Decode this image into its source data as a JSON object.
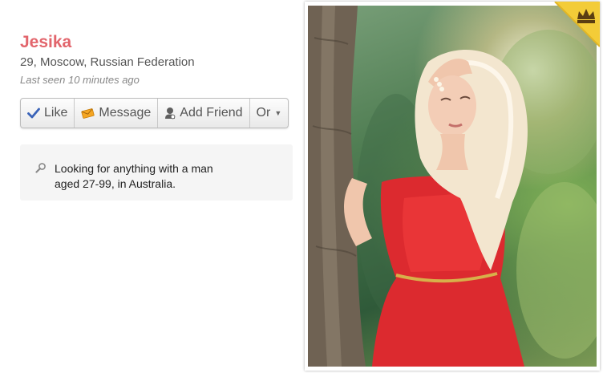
{
  "profile": {
    "name": "Jesika",
    "location": "29, Moscow, Russian Federation",
    "last_seen": "Last seen 10 minutes ago"
  },
  "actions": {
    "like_label": "Like",
    "message_label": "Message",
    "add_friend_label": "Add Friend",
    "more_label": "Or"
  },
  "looking_for": {
    "text": "Looking for anything with a man aged 27-99, in Australia."
  },
  "icons": {
    "like": "checkmark-icon",
    "message": "envelope-icon",
    "add_friend": "user-icon",
    "more": "caret-down-icon",
    "search": "magnifier-icon",
    "premium": "crown-icon"
  },
  "colors": {
    "name": "#e2656c",
    "badge": "#f3cc38",
    "like_icon": "#3a63b8",
    "message_icon": "#f5a623"
  }
}
